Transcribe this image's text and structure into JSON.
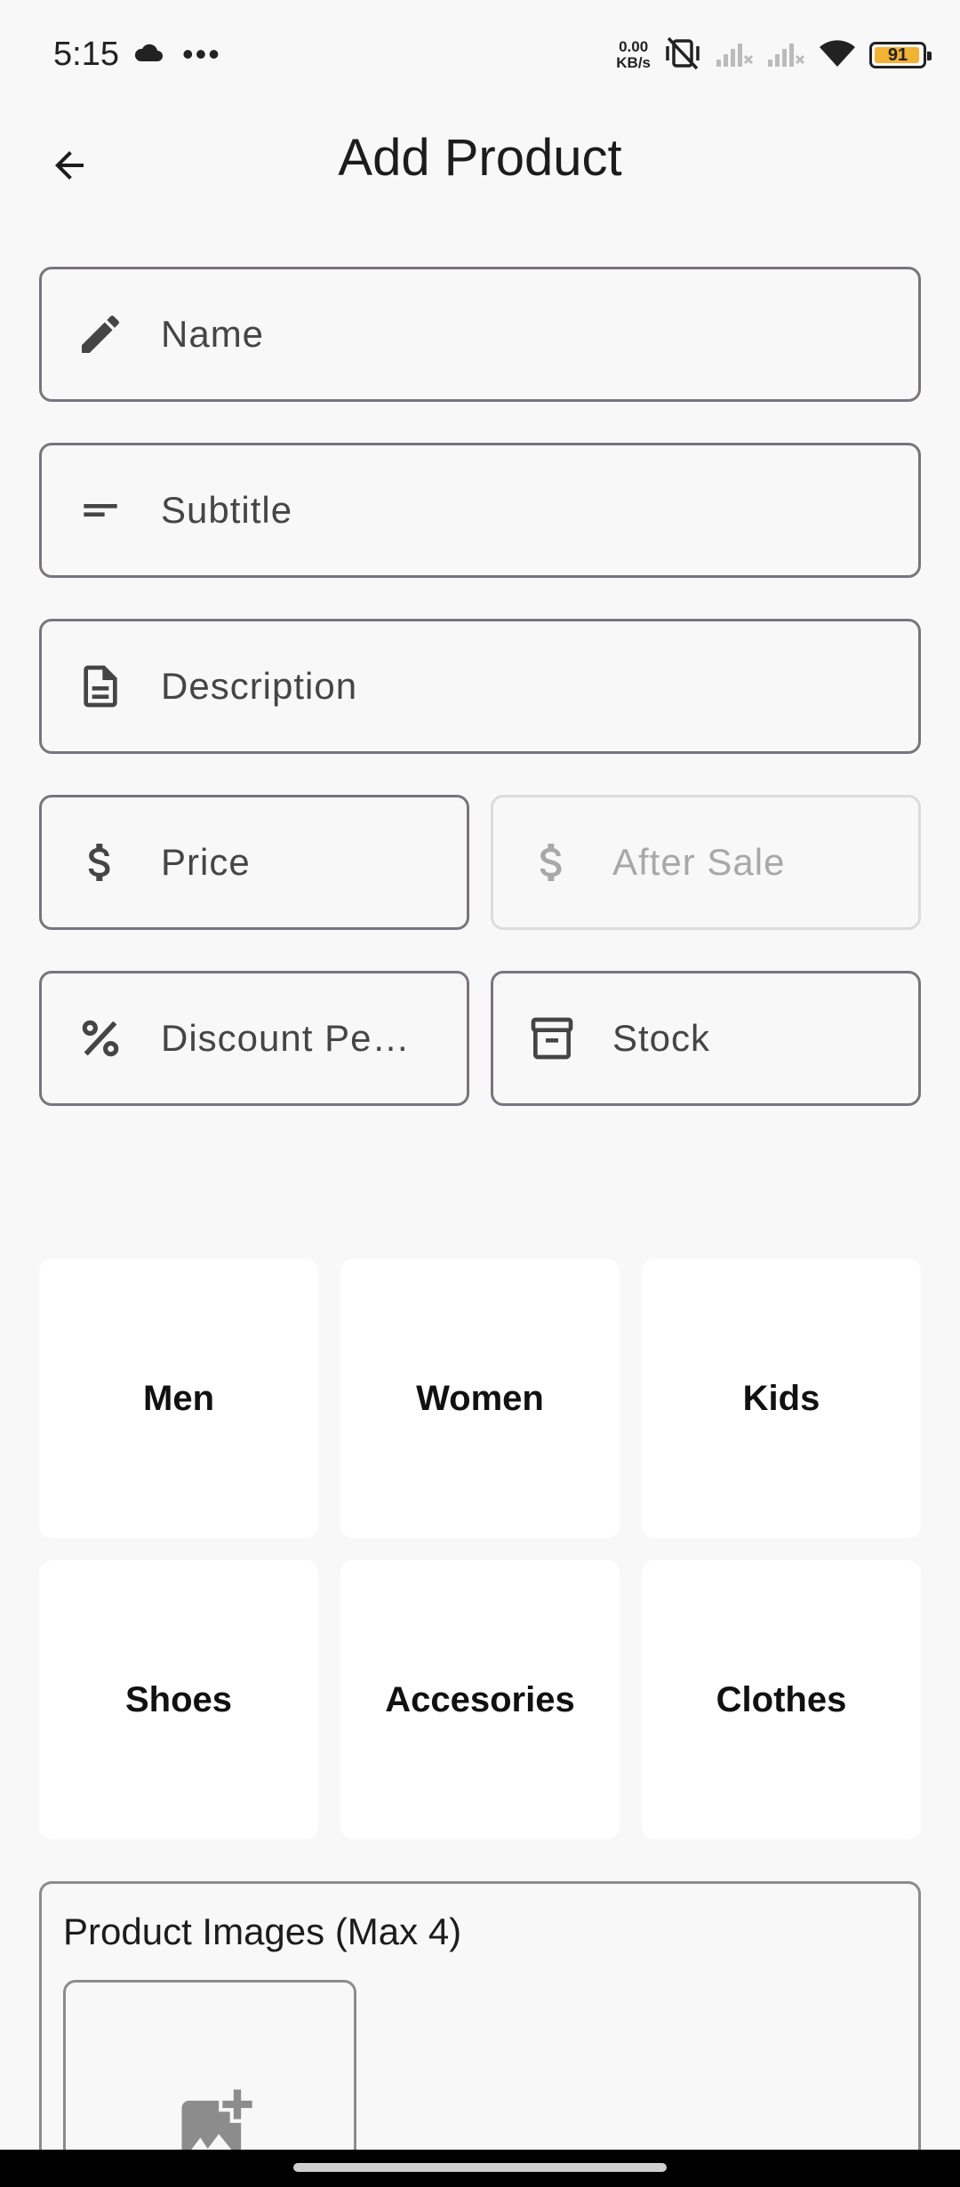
{
  "status_bar": {
    "time": "5:15",
    "dots": "•••",
    "net_speed_value": "0.00",
    "net_speed_unit": "KB/s",
    "battery_level": "91",
    "battery_color": "#f2b233"
  },
  "app_bar": {
    "title": "Add Product",
    "back_icon": "arrow-left-icon"
  },
  "form": {
    "name_placeholder": "Name",
    "subtitle_placeholder": "Subtitle",
    "description_placeholder": "Description",
    "price_placeholder": "Price",
    "after_sale_placeholder": "After Sale",
    "discount_placeholder": "Discount Pe…",
    "stock_placeholder": "Stock"
  },
  "categories": [
    "Men",
    "Women",
    "Kids",
    "Shoes",
    "Accesories",
    "Clothes"
  ],
  "images": {
    "title": "Product Images (Max 4)",
    "add_icon": "add-photo-icon"
  }
}
